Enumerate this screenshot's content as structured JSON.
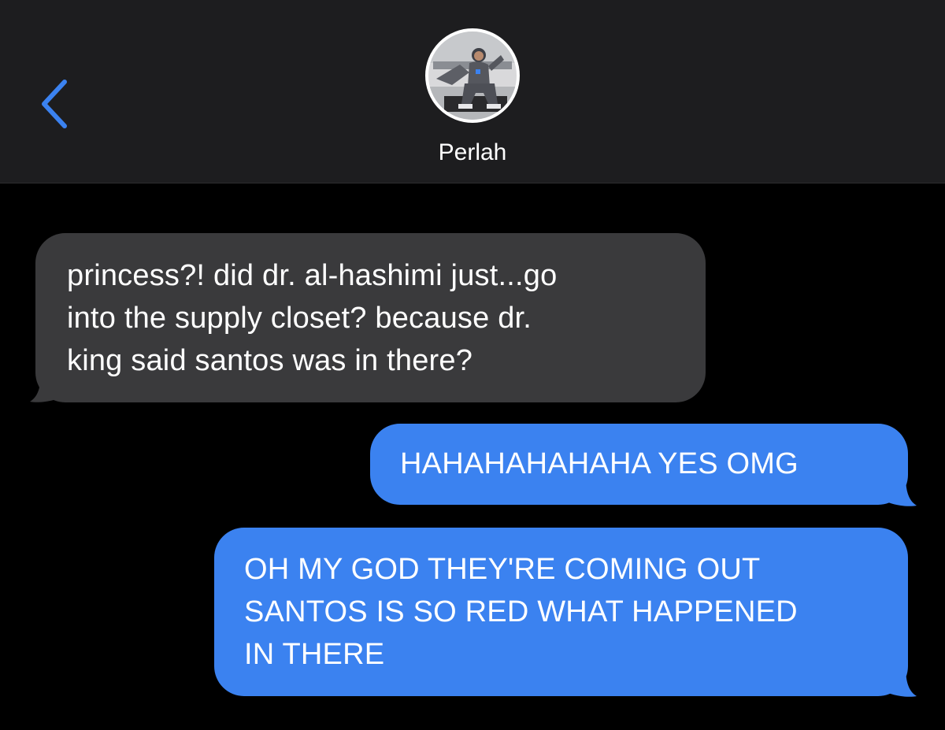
{
  "header": {
    "back_icon": "chevron-left-icon",
    "contact_name": "Perlah",
    "avatar_icon": "contact-photo",
    "accent_color": "#3b82f0"
  },
  "messages": [
    {
      "direction": "incoming",
      "text": "princess?! did dr. al-hashimi just...go\ninto the supply closet? because dr.\nking said santos was in there?",
      "bubble_color": "#3a3a3c"
    },
    {
      "direction": "outgoing",
      "text": "HAHAHAHAHAHA YES OMG",
      "bubble_color": "#3b82f0"
    },
    {
      "direction": "outgoing",
      "text": "OH MY GOD THEY'RE COMING OUT\nSANTOS IS SO RED WHAT HAPPENED\nIN THERE",
      "bubble_color": "#3b82f0"
    }
  ]
}
